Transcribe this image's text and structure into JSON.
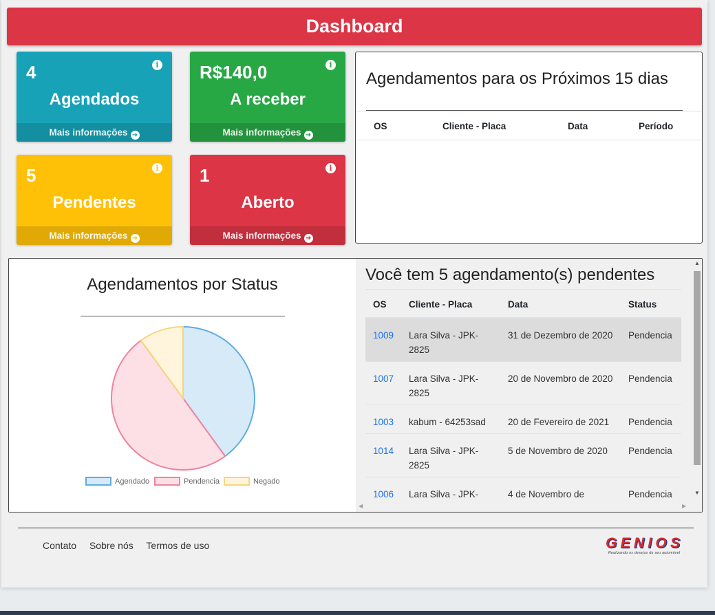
{
  "header": {
    "title": "Dashboard"
  },
  "boxes": [
    {
      "value": "4",
      "label": "Agendados",
      "link": "Mais informações",
      "color": "#17a2b8"
    },
    {
      "value": "R$140,0",
      "label": "A receber",
      "link": "Mais informações",
      "color": "#28a745"
    },
    {
      "value": "5",
      "label": "Pendentes",
      "link": "Mais informações",
      "color": "#ffc107"
    },
    {
      "value": "1",
      "label": "Aberto",
      "link": "Mais informações",
      "color": "#dc3545"
    }
  ],
  "upcoming": {
    "title": "Agendamentos para os Próximos 15 dias",
    "columns": [
      "OS",
      "Cliente - Placa",
      "Data",
      "Período"
    ]
  },
  "status_chart": {
    "title": "Agendamentos por Status"
  },
  "chart_data": {
    "type": "pie",
    "title": "Agendamentos por Status",
    "categories": [
      "Agendado",
      "Pendencia",
      "Negado"
    ],
    "values": [
      4,
      5,
      1
    ],
    "colors": {
      "fill": [
        "#d6eaf8",
        "#fde0e6",
        "#fff5dd"
      ],
      "stroke": [
        "#5dade2",
        "#f1829d",
        "#f5d67d"
      ]
    },
    "legend_position": "bottom"
  },
  "pending": {
    "title": "Você tem 5 agendamento(s) pendentes",
    "columns": [
      "OS",
      "Cliente - Placa",
      "Data",
      "Status"
    ],
    "rows": [
      {
        "os": "1009",
        "client": "Lara Silva - JPK-2825",
        "date": "31 de Dezembro de 2020",
        "status": "Pendencia"
      },
      {
        "os": "1007",
        "client": "Lara Silva - JPK-2825",
        "date": "20 de Novembro de 2020",
        "status": "Pendencia"
      },
      {
        "os": "1003",
        "client": "kabum - 64253sad",
        "date": "20 de Fevereiro de 2021",
        "status": "Pendencia"
      },
      {
        "os": "1014",
        "client": "Lara Silva - JPK-2825",
        "date": "5 de Novembro de 2020",
        "status": "Pendencia"
      },
      {
        "os": "1006",
        "client": "Lara Silva - JPK-",
        "date": "4 de Novembro de",
        "status": "Pendencia"
      }
    ]
  },
  "footer": {
    "links": [
      "Contato",
      "Sobre nós",
      "Termos de uso"
    ],
    "logo_text": "GENIOS",
    "logo_tagline": "Realizando os desejos do seu automóvel"
  }
}
